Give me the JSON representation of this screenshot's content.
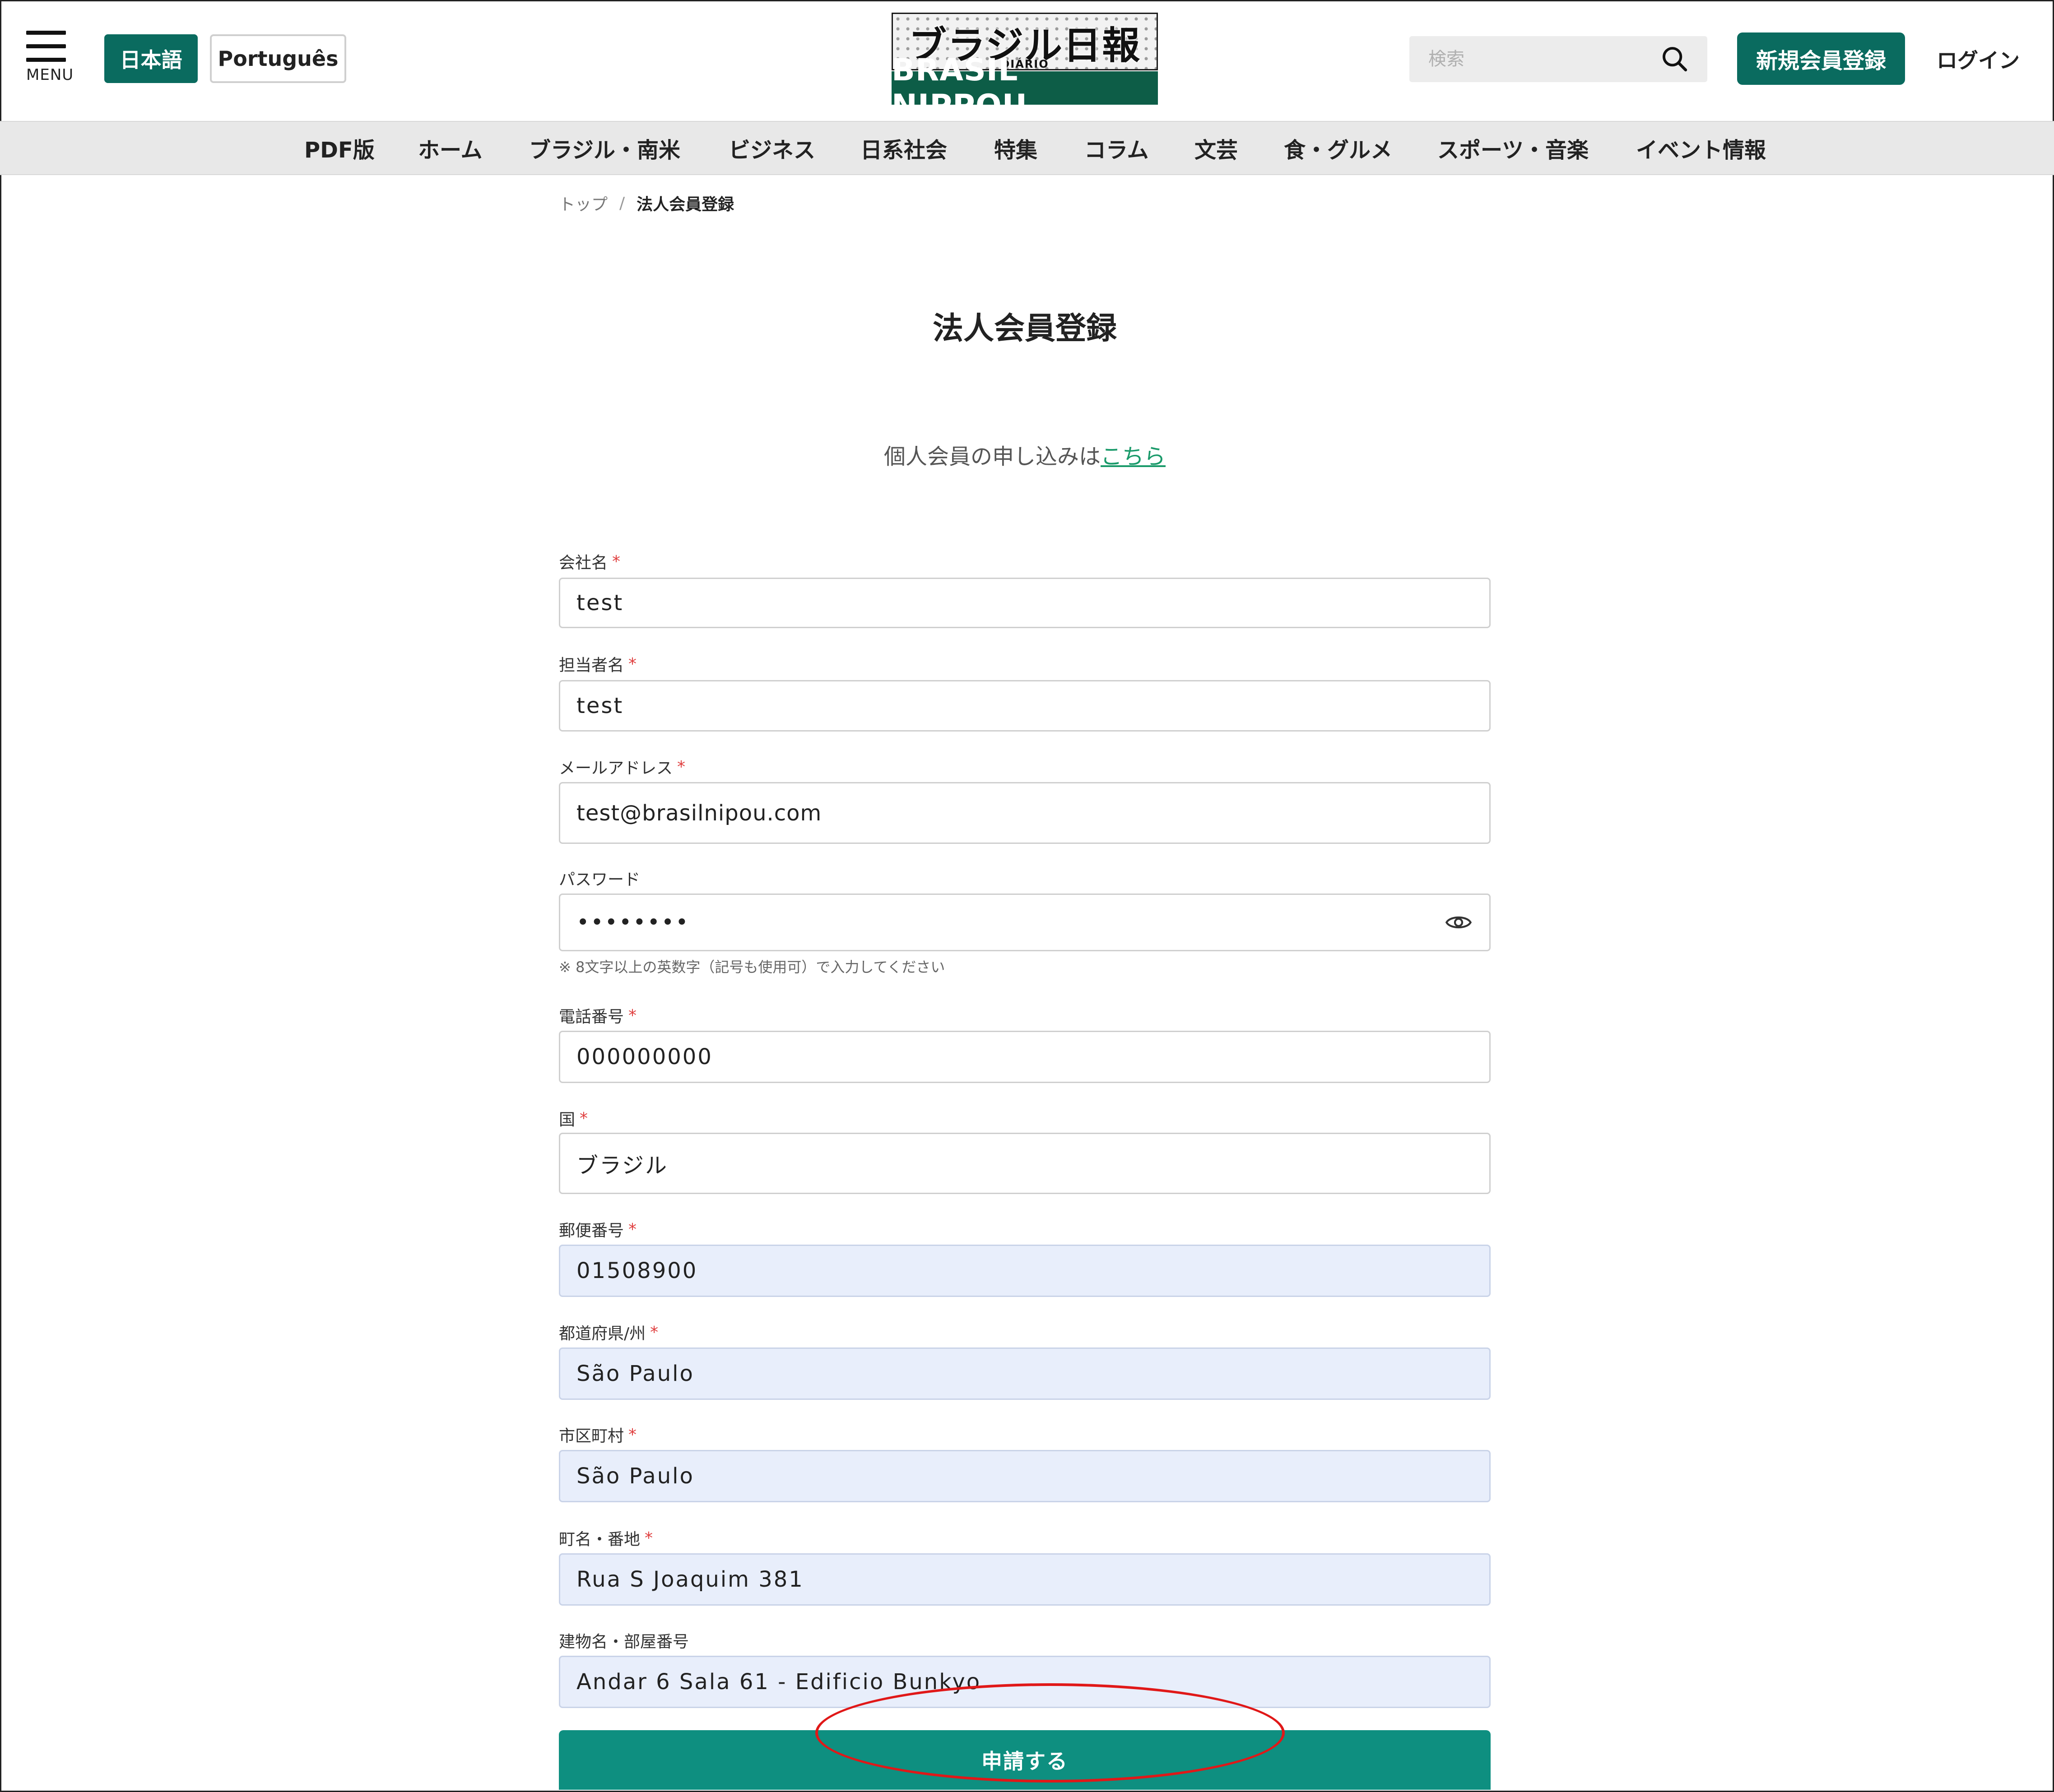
{
  "header": {
    "menu_label": "MENU",
    "lang_ja": "日本語",
    "lang_pt": "Português",
    "logo_jp": "ブラジル日報",
    "logo_sub": "DIÁRIO",
    "logo_en": "BRASIL NIPPOU",
    "search_placeholder": "検索",
    "register_label": "新規会員登録",
    "login_label": "ログイン"
  },
  "nav": {
    "items": [
      "PDF版",
      "ホーム",
      "ブラジル・南米",
      "ビジネス",
      "日系社会",
      "特集",
      "コラム",
      "文芸",
      "食・グルメ",
      "スポーツ・音楽",
      "イベント情報"
    ]
  },
  "breadcrumb": {
    "home": "トップ",
    "separator": "/",
    "current": "法人会員登録"
  },
  "page": {
    "title": "法人会員登録",
    "individual_note": "個人会員の申し込みは",
    "individual_link": "こちら"
  },
  "form": {
    "required_mark": "*",
    "company": {
      "label": "会社名",
      "value": "test"
    },
    "contact": {
      "label": "担当者名",
      "value": "test"
    },
    "email": {
      "label": "メールアドレス",
      "value": "test@brasilnipou.com"
    },
    "password": {
      "label": "パスワード",
      "value": "••••••••",
      "hint": "※ 8文字以上の英数字（記号も使用可）で入力してください"
    },
    "phone": {
      "label": "電話番号",
      "value": "000000000"
    },
    "country": {
      "label": "国",
      "value": "ブラジル"
    },
    "postal": {
      "label": "郵便番号",
      "value": "01508900"
    },
    "state": {
      "label": "都道府県/州",
      "value": "São Paulo"
    },
    "city": {
      "label": "市区町村",
      "value": "São Paulo"
    },
    "street": {
      "label": "町名・番地",
      "value": "Rua S Joaquim 381"
    },
    "building": {
      "label": "建物名・部屋番号",
      "value": "Andar 6 Sala 61 - Edificio Bunkyo"
    },
    "submit_label": "申請する"
  },
  "colors": {
    "brand_green": "#0a6b5f",
    "submit_green": "#0e8f80",
    "autofill_bg": "#e8eefb",
    "annotation_red": "#e01818"
  }
}
